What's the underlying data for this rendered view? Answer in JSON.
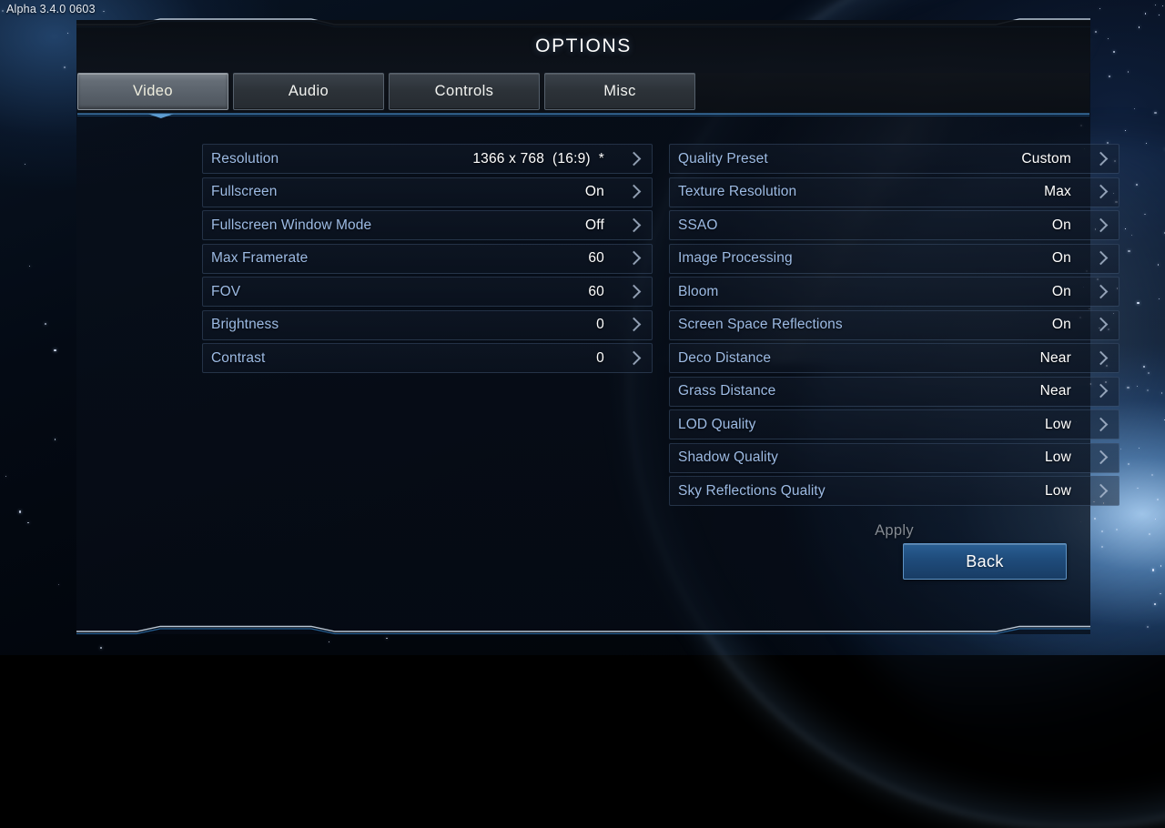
{
  "version_text": "Alpha 3.4.0 0603",
  "header": {
    "title": "OPTIONS"
  },
  "tabs": [
    {
      "label": "Video",
      "active": true
    },
    {
      "label": "Audio",
      "active": false
    },
    {
      "label": "Controls",
      "active": false
    },
    {
      "label": "Misc",
      "active": false
    }
  ],
  "settings": {
    "left_column": [
      {
        "label": "Resolution",
        "value": "1366 x 768  (16:9)  *"
      },
      {
        "label": "Fullscreen",
        "value": "On"
      },
      {
        "label": "Fullscreen Window Mode",
        "value": "Off"
      },
      {
        "label": "Max Framerate",
        "value": "60"
      },
      {
        "label": "FOV",
        "value": "60"
      },
      {
        "label": "Brightness",
        "value": "0"
      },
      {
        "label": "Contrast",
        "value": "0"
      }
    ],
    "right_column": [
      {
        "label": "Quality Preset",
        "value": "Custom"
      },
      {
        "label": "Texture Resolution",
        "value": "Max"
      },
      {
        "label": "SSAO",
        "value": "On"
      },
      {
        "label": "Image Processing",
        "value": "On"
      },
      {
        "label": "Bloom",
        "value": "On"
      },
      {
        "label": "Screen Space Reflections",
        "value": "On"
      },
      {
        "label": "Deco Distance",
        "value": "Near"
      },
      {
        "label": "Grass Distance",
        "value": "Near"
      },
      {
        "label": "LOD Quality",
        "value": "Low"
      },
      {
        "label": "Shadow Quality",
        "value": "Low"
      },
      {
        "label": "Sky Reflections Quality",
        "value": "Low"
      }
    ]
  },
  "buttons": {
    "apply_label": "Apply",
    "apply_enabled": false,
    "back_label": "Back"
  },
  "colors": {
    "label_blue": "#9dbbe4",
    "value_white": "#ffffff",
    "active_tab_text": "#efeede",
    "back_button_fill": "#1f4c7c",
    "apply_disabled_text": "#848a92",
    "panel_background": "#070d17"
  }
}
